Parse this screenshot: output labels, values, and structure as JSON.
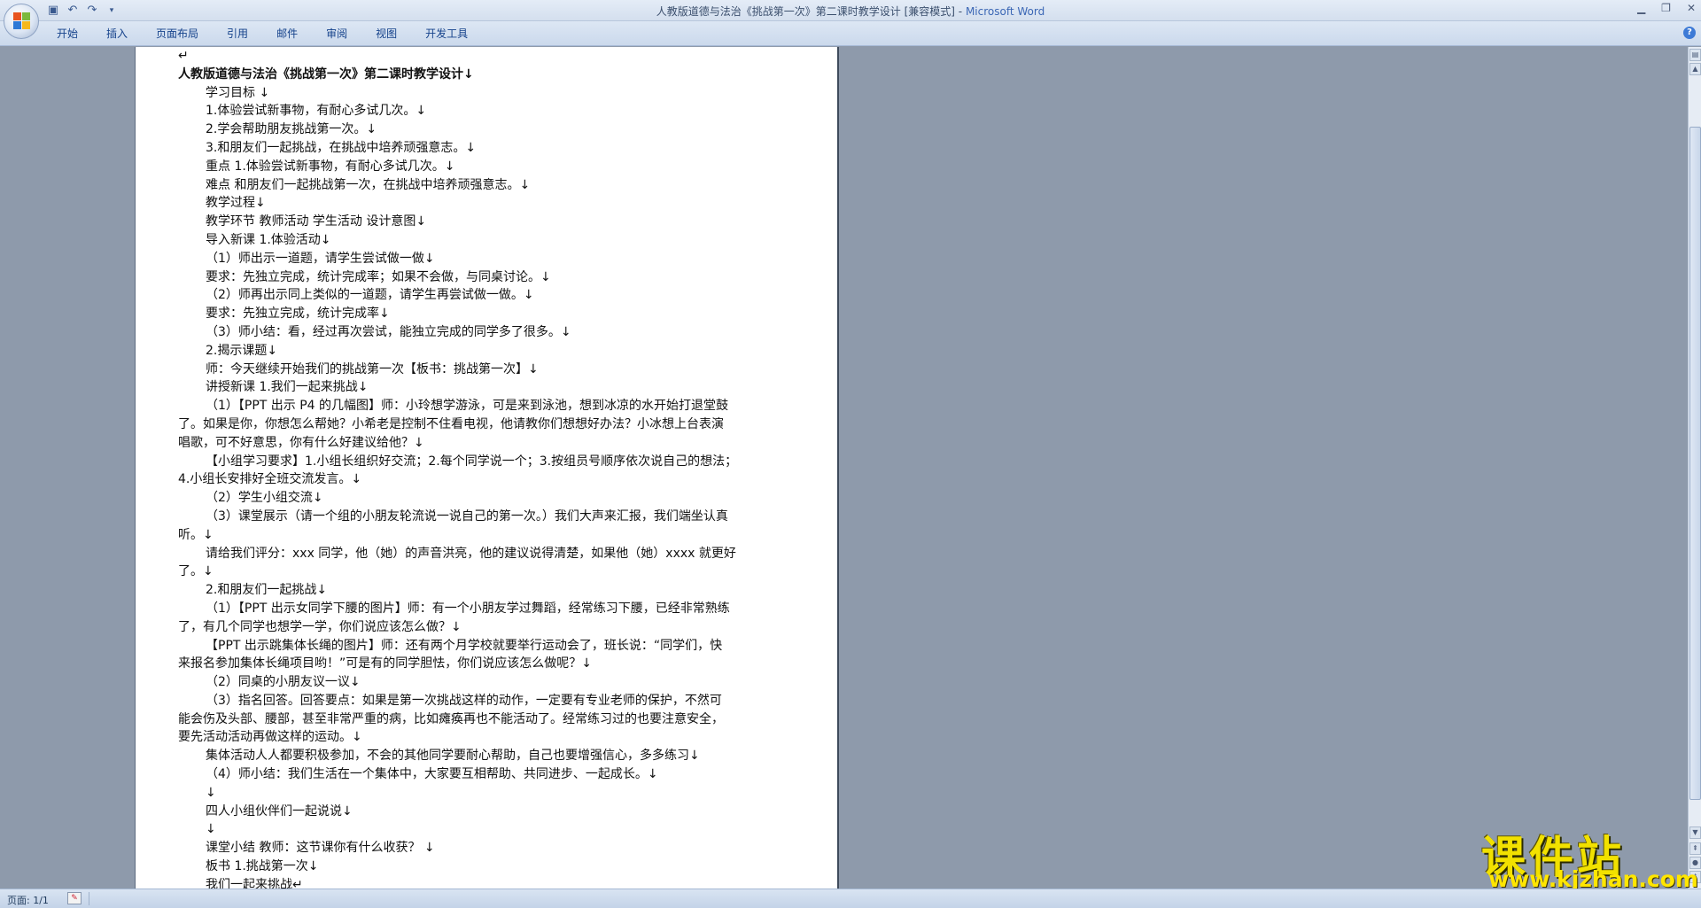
{
  "window": {
    "title": "人教版道德与法治《挑战第一次》第二课时教学设计 [兼容模式]",
    "app_name": "Microsoft Word",
    "title_separator": " - "
  },
  "qat": {
    "icons": [
      "save-icon",
      "undo-icon",
      "redo-icon",
      "customize-icon"
    ]
  },
  "ribbon": {
    "tabs": [
      "开始",
      "插入",
      "页面布局",
      "引用",
      "邮件",
      "审阅",
      "视图",
      "开发工具"
    ]
  },
  "document": {
    "lines": [
      {
        "text": "↵",
        "indent": false,
        "heading": false
      },
      {
        "text": "人教版道德与法治《挑战第一次》第二课时教学设计↓",
        "indent": false,
        "heading": true
      },
      {
        "text": "学习目标 ↓",
        "indent": true,
        "heading": false
      },
      {
        "text": "1.体验尝试新事物，有耐心多试几次。↓",
        "indent": true,
        "heading": false
      },
      {
        "text": "2.学会帮助朋友挑战第一次。↓",
        "indent": true,
        "heading": false
      },
      {
        "text": "3.和朋友们一起挑战，在挑战中培养顽强意志。↓",
        "indent": true,
        "heading": false
      },
      {
        "text": "重点 1.体验尝试新事物，有耐心多试几次。↓",
        "indent": true,
        "heading": false
      },
      {
        "text": "难点 和朋友们一起挑战第一次，在挑战中培养顽强意志。↓",
        "indent": true,
        "heading": false
      },
      {
        "text": "教学过程↓",
        "indent": true,
        "heading": false
      },
      {
        "text": "教学环节 教师活动 学生活动 设计意图↓",
        "indent": true,
        "heading": false
      },
      {
        "text": "导入新课 1.体验活动↓",
        "indent": true,
        "heading": false
      },
      {
        "text": "（1）师出示一道题，请学生尝试做一做↓",
        "indent": true,
        "heading": false
      },
      {
        "text": "要求：先独立完成，统计完成率；如果不会做，与同桌讨论。↓",
        "indent": true,
        "heading": false
      },
      {
        "text": "（2）师再出示同上类似的一道题，请学生再尝试做一做。↓",
        "indent": true,
        "heading": false
      },
      {
        "text": "要求：先独立完成，统计完成率↓",
        "indent": true,
        "heading": false
      },
      {
        "text": "（3）师小结：看，经过再次尝试，能独立完成的同学多了很多。↓",
        "indent": true,
        "heading": false
      },
      {
        "text": "2.揭示课题↓",
        "indent": true,
        "heading": false
      },
      {
        "text": "师：今天继续开始我们的挑战第一次【板书：挑战第一次】↓",
        "indent": true,
        "heading": false
      },
      {
        "text": "讲授新课 1.我们一起来挑战↓",
        "indent": true,
        "heading": false
      },
      {
        "text": "（1）【PPT 出示 P4 的几幅图】师：小玲想学游泳，可是来到泳池，想到冰凉的水开始打退堂鼓",
        "indent": true,
        "heading": false
      },
      {
        "text": "了。如果是你，你想怎么帮她？小希老是控制不住看电视，他请教你们想想好办法？小冰想上台表演",
        "indent": false,
        "heading": false
      },
      {
        "text": "唱歌，可不好意思，你有什么好建议给他？↓",
        "indent": false,
        "heading": false
      },
      {
        "text": "【小组学习要求】1.小组长组织好交流；2.每个同学说一个；3.按组员号顺序依次说自己的想法；",
        "indent": true,
        "heading": false
      },
      {
        "text": "4.小组长安排好全班交流发言。↓",
        "indent": false,
        "heading": false
      },
      {
        "text": "（2）学生小组交流↓",
        "indent": true,
        "heading": false
      },
      {
        "text": "（3）课堂展示（请一个组的小朋友轮流说一说自己的第一次。）我们大声来汇报，我们端坐认真",
        "indent": true,
        "heading": false
      },
      {
        "text": "听。↓",
        "indent": false,
        "heading": false
      },
      {
        "text": "请给我们评分：xxx 同学，他（她）的声音洪亮，他的建议说得清楚，如果他（她）xxxx 就更好",
        "indent": true,
        "heading": false
      },
      {
        "text": "了。↓",
        "indent": false,
        "heading": false
      },
      {
        "text": "2.和朋友们一起挑战↓",
        "indent": true,
        "heading": false
      },
      {
        "text": "（1）【PPT 出示女同学下腰的图片】师：有一个小朋友学过舞蹈，经常练习下腰，已经非常熟练",
        "indent": true,
        "heading": false
      },
      {
        "text": "了，有几个同学也想学一学，你们说应该怎么做？↓",
        "indent": false,
        "heading": false
      },
      {
        "text": "【PPT 出示跳集体长绳的图片】师：还有两个月学校就要举行运动会了，班长说：“同学们，快",
        "indent": true,
        "heading": false
      },
      {
        "text": "来报名参加集体长绳项目哟！”可是有的同学胆怯，你们说应该怎么做呢？↓",
        "indent": false,
        "heading": false
      },
      {
        "text": "（2）同桌的小朋友议一议↓",
        "indent": true,
        "heading": false
      },
      {
        "text": "（3）指名回答。回答要点：如果是第一次挑战这样的动作，一定要有专业老师的保护，不然可",
        "indent": true,
        "heading": false
      },
      {
        "text": "能会伤及头部、腰部，甚至非常严重的病，比如瘫痪再也不能活动了。经常练习过的也要注意安全，",
        "indent": false,
        "heading": false
      },
      {
        "text": "要先活动活动再做这样的运动。↓",
        "indent": false,
        "heading": false
      },
      {
        "text": "集体活动人人都要积极参加，不会的其他同学要耐心帮助，自己也要增强信心，多多练习↓",
        "indent": true,
        "heading": false
      },
      {
        "text": "（4）师小结：我们生活在一个集体中，大家要互相帮助、共同进步、一起成长。↓",
        "indent": true,
        "heading": false
      },
      {
        "text": "↓",
        "indent": true,
        "heading": false
      },
      {
        "text": "四人小组伙伴们一起说说↓",
        "indent": true,
        "heading": false
      },
      {
        "text": "↓",
        "indent": true,
        "heading": false
      },
      {
        "text": "课堂小结 教师：这节课你有什么收获？ ↓",
        "indent": true,
        "heading": false
      },
      {
        "text": "板书 1.挑战第一次↓",
        "indent": true,
        "heading": false
      },
      {
        "text": "我们一起来挑战↵",
        "indent": true,
        "heading": false
      }
    ]
  },
  "statusbar": {
    "page_label": "页面: 1/1"
  },
  "watermark": {
    "title": "课件站",
    "url": "www.kjzhan.com"
  },
  "colors": {
    "background": "#8e9aab",
    "ribbon_text": "#15428b",
    "app_name": "#3b67b5",
    "watermark": "#f2e100"
  }
}
